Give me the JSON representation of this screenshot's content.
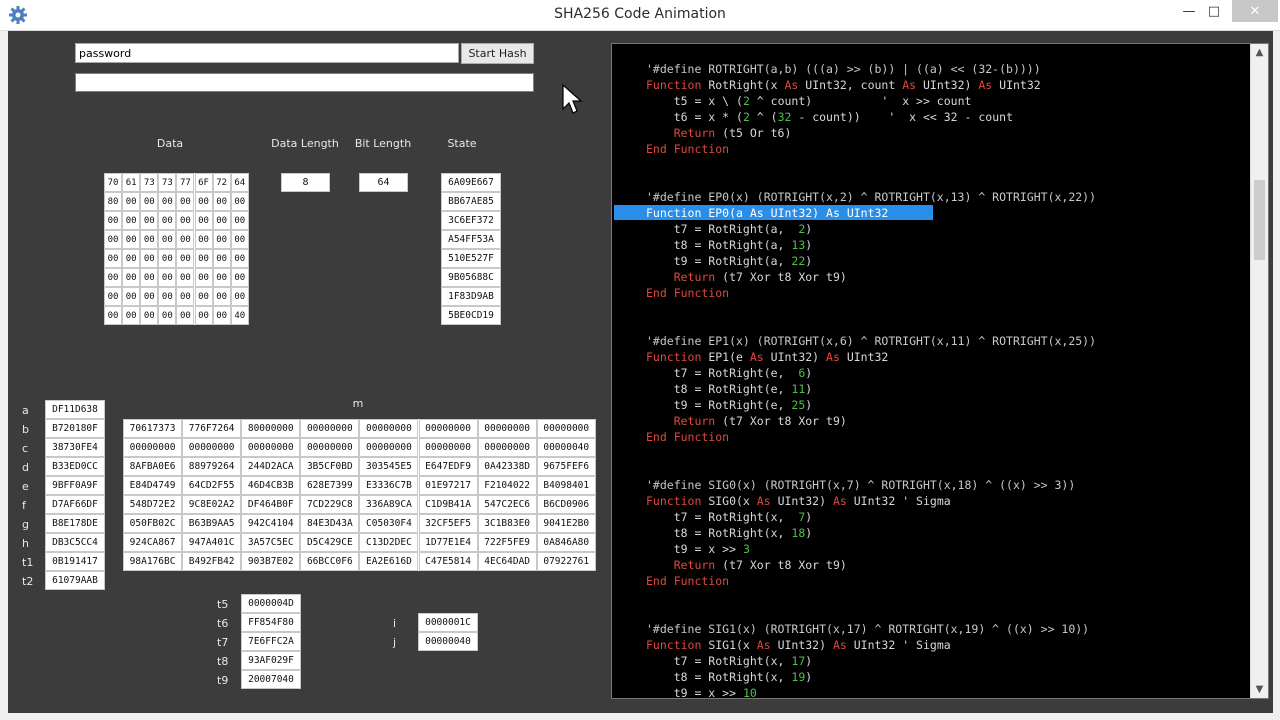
{
  "window": {
    "title": "SHA256 Code Animation"
  },
  "controls": {
    "password_value": "password",
    "start_hash_label": "Start Hash",
    "hash_output_value": ""
  },
  "labels": {
    "data": "Data",
    "data_length": "Data Length",
    "bit_length": "Bit Length",
    "state": "State",
    "m": "m",
    "i": "i",
    "j": "j"
  },
  "data_grid": [
    [
      "70",
      "61",
      "73",
      "73",
      "77",
      "6F",
      "72",
      "64"
    ],
    [
      "80",
      "00",
      "00",
      "00",
      "00",
      "00",
      "00",
      "00"
    ],
    [
      "00",
      "00",
      "00",
      "00",
      "00",
      "00",
      "00",
      "00"
    ],
    [
      "00",
      "00",
      "00",
      "00",
      "00",
      "00",
      "00",
      "00"
    ],
    [
      "00",
      "00",
      "00",
      "00",
      "00",
      "00",
      "00",
      "00"
    ],
    [
      "00",
      "00",
      "00",
      "00",
      "00",
      "00",
      "00",
      "00"
    ],
    [
      "00",
      "00",
      "00",
      "00",
      "00",
      "00",
      "00",
      "00"
    ],
    [
      "00",
      "00",
      "00",
      "00",
      "00",
      "00",
      "00",
      "40"
    ]
  ],
  "data_length": "8",
  "bit_length": "64",
  "state": [
    "6A09E667",
    "BB67AE85",
    "3C6EF372",
    "A54FF53A",
    "510E527F",
    "9B05688C",
    "1F83D9AB",
    "5BE0CD19"
  ],
  "registers": [
    {
      "name": "a",
      "value": "DF11D638"
    },
    {
      "name": "b",
      "value": "B720180F"
    },
    {
      "name": "c",
      "value": "38730FE4"
    },
    {
      "name": "d",
      "value": "B33ED0CC"
    },
    {
      "name": "e",
      "value": "9BFF0A9F"
    },
    {
      "name": "f",
      "value": "D7AF66DF"
    },
    {
      "name": "g",
      "value": "B8E178DE"
    },
    {
      "name": "h",
      "value": "DB3C5CC4"
    },
    {
      "name": "t1",
      "value": "0B191417"
    },
    {
      "name": "t2",
      "value": "61079AAB"
    }
  ],
  "m_grid": [
    [
      "70617373",
      "776F7264",
      "80000000",
      "00000000",
      "00000000",
      "00000000",
      "00000000",
      "00000000"
    ],
    [
      "00000000",
      "00000000",
      "00000000",
      "00000000",
      "00000000",
      "00000000",
      "00000000",
      "00000040"
    ],
    [
      "8AFBA0E6",
      "88979264",
      "244D2ACA",
      "3B5CF0BD",
      "303545E5",
      "E647EDF9",
      "0A42338D",
      "9675FEF6"
    ],
    [
      "E84D4749",
      "64CD2F55",
      "46D4CB3B",
      "628E7399",
      "E3336C7B",
      "01E97217",
      "F2104022",
      "B4098401"
    ],
    [
      "548D72E2",
      "9C8E02A2",
      "DF464B0F",
      "7CD229C8",
      "336A89CA",
      "C1D9B41A",
      "547C2EC6",
      "B6CD0906"
    ],
    [
      "050FB02C",
      "B63B9AA5",
      "942C4104",
      "84E3D43A",
      "C05030F4",
      "32CF5EF5",
      "3C1B83E0",
      "9041E2B0"
    ],
    [
      "924CA867",
      "947A401C",
      "3A57C5EC",
      "D5C429CE",
      "C13D2DEC",
      "1D77E1E4",
      "722F5FE9",
      "0A846A80"
    ],
    [
      "98A176BC",
      "B492FB42",
      "903B7E02",
      "66BCC0F6",
      "EA2E616D",
      "C47E5814",
      "4EC64DAD",
      "07922761"
    ]
  ],
  "temps": [
    {
      "name": "t5",
      "value": "0000004D"
    },
    {
      "name": "t6",
      "value": "FF854F80"
    },
    {
      "name": "t7",
      "value": "7E6FFC2A"
    },
    {
      "name": "t8",
      "value": "93AF029F"
    },
    {
      "name": "t9",
      "value": "20007040"
    }
  ],
  "counters": [
    {
      "name": "i",
      "value": "0000001C"
    },
    {
      "name": "j",
      "value": "00000040"
    }
  ],
  "code_lines": [
    [
      [
        "cm",
        "'#define ROTRIGHT(a,b) (((a) >> (b)) | ((a) << (32-(b))))"
      ]
    ],
    [
      [
        "kw",
        "Function "
      ],
      [
        "tx",
        "RotRight(x "
      ],
      [
        "kw",
        "As "
      ],
      [
        "tx",
        "UInt32, count "
      ],
      [
        "kw",
        "As "
      ],
      [
        "tx",
        "UInt32) "
      ],
      [
        "kw",
        "As "
      ],
      [
        "tx",
        "UInt32"
      ]
    ],
    [
      [
        "tx",
        "    t5 = x \\ ("
      ],
      [
        "num",
        "2"
      ],
      [
        "tx",
        " ^ count)          '  x >> count"
      ]
    ],
    [
      [
        "tx",
        "    t6 = x * ("
      ],
      [
        "num",
        "2"
      ],
      [
        "tx",
        " ^ ("
      ],
      [
        "num",
        "32"
      ],
      [
        "tx",
        " - count))    '  x << 32 - count"
      ]
    ],
    [
      [
        "kw",
        "    Return "
      ],
      [
        "tx",
        "(t5 Or t6)"
      ]
    ],
    [
      [
        "kw",
        "End Function"
      ]
    ],
    [],
    [],
    [
      [
        "cm",
        "'#define EP0(x) (ROTRIGHT(x,2) ^ ROTRIGHT(x,13) ^ ROTRIGHT(x,22))"
      ]
    ],
    [
      [
        "kw",
        "Function "
      ],
      [
        "tx",
        "EP0(a "
      ],
      [
        "kw",
        "As "
      ],
      [
        "tx",
        "UInt32) "
      ],
      [
        "kw",
        "As "
      ],
      [
        "tx",
        "UInt32"
      ]
    ],
    [
      [
        "tx",
        "    t7 = RotRight(a,  "
      ],
      [
        "num",
        "2"
      ],
      [
        "tx",
        ")"
      ]
    ],
    [
      [
        "tx",
        "    t8 = RotRight(a, "
      ],
      [
        "num",
        "13"
      ],
      [
        "tx",
        ")"
      ]
    ],
    [
      [
        "tx",
        "    t9 = RotRight(a, "
      ],
      [
        "num",
        "22"
      ],
      [
        "tx",
        ")"
      ]
    ],
    [
      [
        "kw",
        "    Return "
      ],
      [
        "tx",
        "(t7 Xor t8 Xor t9)"
      ]
    ],
    [
      [
        "kw",
        "End Function"
      ]
    ],
    [],
    [],
    [
      [
        "cm",
        "'#define EP1(x) (ROTRIGHT(x,6) ^ ROTRIGHT(x,11) ^ ROTRIGHT(x,25))"
      ]
    ],
    [
      [
        "kw",
        "Function "
      ],
      [
        "tx",
        "EP1(e "
      ],
      [
        "kw",
        "As "
      ],
      [
        "tx",
        "UInt32) "
      ],
      [
        "kw",
        "As "
      ],
      [
        "tx",
        "UInt32"
      ]
    ],
    [
      [
        "tx",
        "    t7 = RotRight(e,  "
      ],
      [
        "num",
        "6"
      ],
      [
        "tx",
        ")"
      ]
    ],
    [
      [
        "tx",
        "    t8 = RotRight(e, "
      ],
      [
        "num",
        "11"
      ],
      [
        "tx",
        ")"
      ]
    ],
    [
      [
        "tx",
        "    t9 = RotRight(e, "
      ],
      [
        "num",
        "25"
      ],
      [
        "tx",
        ")"
      ]
    ],
    [
      [
        "kw",
        "    Return "
      ],
      [
        "tx",
        "(t7 Xor t8 Xor t9)"
      ]
    ],
    [
      [
        "kw",
        "End Function"
      ]
    ],
    [],
    [],
    [
      [
        "cm",
        "'#define SIG0(x) (ROTRIGHT(x,7) ^ ROTRIGHT(x,18) ^ ((x) >> 3))"
      ]
    ],
    [
      [
        "kw",
        "Function "
      ],
      [
        "tx",
        "SIG0(x "
      ],
      [
        "kw",
        "As "
      ],
      [
        "tx",
        "UInt32) "
      ],
      [
        "kw",
        "As "
      ],
      [
        "tx",
        "UInt32 ' Sigma"
      ]
    ],
    [
      [
        "tx",
        "    t7 = RotRight(x,  "
      ],
      [
        "num",
        "7"
      ],
      [
        "tx",
        ")"
      ]
    ],
    [
      [
        "tx",
        "    t8 = RotRight(x, "
      ],
      [
        "num",
        "18"
      ],
      [
        "tx",
        ")"
      ]
    ],
    [
      [
        "tx",
        "    t9 = x >> "
      ],
      [
        "num",
        "3"
      ]
    ],
    [
      [
        "kw",
        "    Return "
      ],
      [
        "tx",
        "(t7 Xor t8 Xor t9)"
      ]
    ],
    [
      [
        "kw",
        "End Function"
      ]
    ],
    [],
    [],
    [
      [
        "cm",
        "'#define SIG1(x) (ROTRIGHT(x,17) ^ ROTRIGHT(x,19) ^ ((x) >> 10))"
      ]
    ],
    [
      [
        "kw",
        "Function "
      ],
      [
        "tx",
        "SIG1(x "
      ],
      [
        "kw",
        "As "
      ],
      [
        "tx",
        "UInt32) "
      ],
      [
        "kw",
        "As "
      ],
      [
        "tx",
        "UInt32 ' Sigma"
      ]
    ],
    [
      [
        "tx",
        "    t7 = RotRight(x, "
      ],
      [
        "num",
        "17"
      ],
      [
        "tx",
        ")"
      ]
    ],
    [
      [
        "tx",
        "    t8 = RotRight(x, "
      ],
      [
        "num",
        "19"
      ],
      [
        "tx",
        ")"
      ]
    ],
    [
      [
        "tx",
        "    t9 = x >> "
      ],
      [
        "num",
        "10"
      ]
    ]
  ],
  "highlighted_line": 9,
  "colors": {
    "background": "#3c3c3c",
    "code_background": "#000000",
    "keyword": "#e0483e",
    "number": "#4fbf4f",
    "highlight": "#2a8ee8"
  }
}
